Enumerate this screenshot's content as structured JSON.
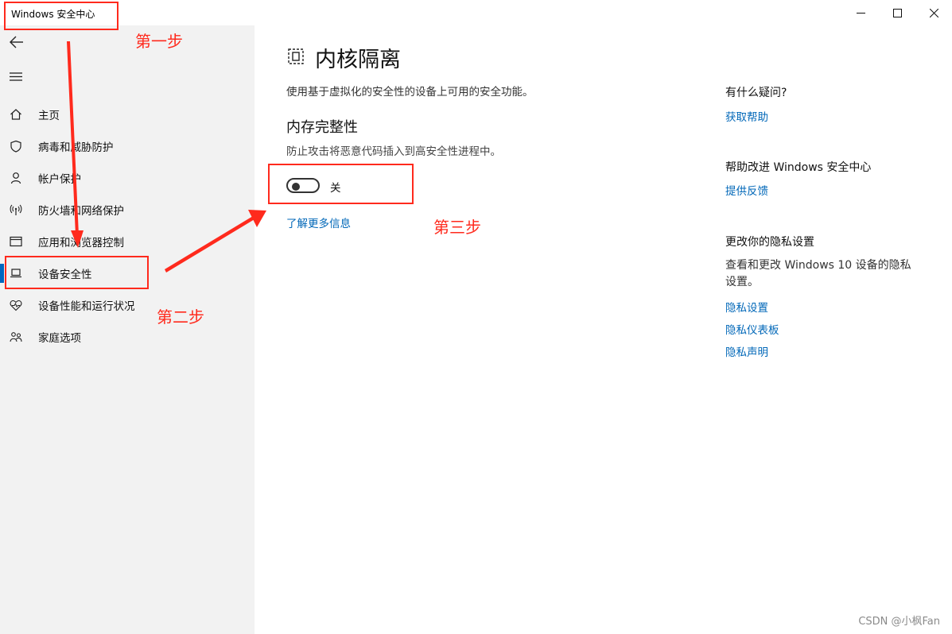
{
  "window": {
    "title": "Windows 安全中心",
    "minimize_icon": "minimize-icon",
    "maximize_icon": "maximize-icon",
    "close_icon": "close-icon"
  },
  "sidebar": {
    "items": [
      {
        "label": "主页",
        "icon": "home-icon"
      },
      {
        "label": "病毒和威胁防护",
        "icon": "shield-icon"
      },
      {
        "label": "帐户保护",
        "icon": "person-icon"
      },
      {
        "label": "防火墙和网络保护",
        "icon": "antenna-icon"
      },
      {
        "label": "应用和浏览器控制",
        "icon": "browser-window-icon"
      },
      {
        "label": "设备安全性",
        "icon": "laptop-icon",
        "active": true
      },
      {
        "label": "设备性能和运行状况",
        "icon": "heart-pulse-icon"
      },
      {
        "label": "家庭选项",
        "icon": "family-icon"
      }
    ],
    "accent_color": "#0067c0"
  },
  "main": {
    "title": "内核隔离",
    "description": "使用基于虚拟化的安全性的设备上可用的安全功能。",
    "section": {
      "title": "内存完整性",
      "description": "防止攻击将恶意代码插入到高安全性进程中。",
      "toggle_state": "关",
      "toggle_on": false
    },
    "learn_more": "了解更多信息"
  },
  "right_panel": {
    "questions": {
      "heading": "有什么疑问?",
      "link": "获取帮助"
    },
    "improve": {
      "heading": "帮助改进 Windows 安全中心",
      "link": "提供反馈"
    },
    "privacy": {
      "heading": "更改你的隐私设置",
      "text": "查看和更改 Windows 10 设备的隐私设置。",
      "links": [
        "隐私设置",
        "隐私仪表板",
        "隐私声明"
      ]
    },
    "link_color": "#0067b8"
  },
  "annotations": {
    "step1": "第一步",
    "step2": "第二步",
    "step3": "第三步",
    "color": "#ff2a1d"
  },
  "watermark": "CSDN @小枫Fan"
}
